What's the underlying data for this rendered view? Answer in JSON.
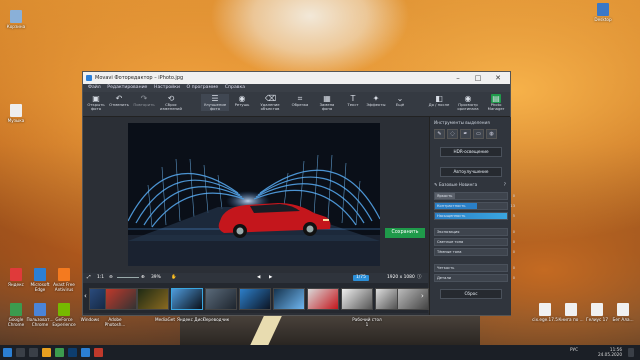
{
  "desktop": {
    "left_icons": [
      {
        "label": "Корзина",
        "color": "#8ab0d8"
      },
      {
        "label": "Яндекс",
        "color": "#e03a3a"
      },
      {
        "label": "Google Chrome",
        "color": "#3c9b4e"
      },
      {
        "label": "Музыка",
        "color": "#eee"
      },
      {
        "label": "Microsoft Edge",
        "color": "#2b7fd4"
      },
      {
        "label": "Пользоват... Chrome",
        "color": "#4a84d8"
      },
      {
        "label": "Avast Free Antivirus",
        "color": "#f47a1f"
      },
      {
        "label": "GeForce Experience",
        "color": "#76b900"
      },
      {
        "label": "Windows",
        "color": "#2a2a2a"
      },
      {
        "label": "Adobe Photosh...",
        "color": "#0d3d6e"
      },
      {
        "label": "MediaGet",
        "color": "#2ca84a"
      },
      {
        "label": "Яндекс Диск",
        "color": "#2f6fc0"
      },
      {
        "label": "Переводчик",
        "color": "#c0392b"
      }
    ],
    "right_icons": [
      {
        "label": "Desktop",
        "color": "#3a78c6"
      },
      {
        "label": "Рабочий стол 1",
        "color": "#d4d4d4"
      },
      {
        "label": "cix.ege.17.5",
        "color": "#f0f0f0"
      },
      {
        "label": "Книга по ...",
        "color": "#f0f0f0"
      },
      {
        "label": "Гелиус 17",
        "color": "#f0f0f0"
      },
      {
        "label": "Бег Ала...",
        "color": "#f0f0f0"
      }
    ]
  },
  "window": {
    "title": "Movavi Фоторедактор – iPhoto.jpg",
    "controls": {
      "minimize": "–",
      "maximize": "□",
      "close": "✕"
    },
    "menu": [
      "Файл",
      "Редактирование",
      "Настройки",
      "О программе",
      "Справка"
    ],
    "toolbar": [
      {
        "label": "Открыть фото",
        "icon": "folder-icon",
        "glyph": "▣"
      },
      {
        "label": "Отменить",
        "icon": "undo-icon",
        "glyph": "↶"
      },
      {
        "label": "Повторить",
        "icon": "redo-icon",
        "glyph": "↷"
      },
      {
        "label": "Сброс изменений",
        "icon": "reset-icon",
        "glyph": "⟲"
      },
      {
        "label": "Улучшение фото",
        "icon": "enhance-icon",
        "glyph": "☰"
      },
      {
        "label": "Ретушь",
        "icon": "retouch-icon",
        "glyph": "◉"
      },
      {
        "label": "Удаление объектов",
        "icon": "eraser-icon",
        "glyph": "⌫"
      },
      {
        "label": "Обрезка",
        "icon": "crop-icon",
        "glyph": "⌗"
      },
      {
        "label": "Замена фона",
        "icon": "background-icon",
        "glyph": "▦"
      },
      {
        "label": "Текст",
        "icon": "text-icon",
        "glyph": "T"
      },
      {
        "label": "Эффекты",
        "icon": "effects-icon",
        "glyph": "✦"
      },
      {
        "label": "Ещё",
        "icon": "more-icon",
        "glyph": "⌄"
      },
      {
        "label": "До / после",
        "icon": "before-after-icon",
        "glyph": "◧"
      },
      {
        "label": "Просмотр оригинала",
        "icon": "eye-icon",
        "glyph": "◉"
      },
      {
        "label": "Photo Manager",
        "icon": "photo-manager-icon",
        "glyph": "▤"
      }
    ],
    "zoom": {
      "fit": "1:1",
      "value": "39%"
    },
    "image_size": "1920 x 1080",
    "page_badge": "1/75",
    "panel": {
      "tools_label": "Инструменты выделения",
      "hdr_button": "HDR-освещение",
      "auto_button": "Автоулучшение",
      "basic_header": "Базовые Новинга",
      "sliders": [
        {
          "label": "Яркость",
          "value": 0,
          "color": "#5a606a"
        },
        {
          "label": "Контрастность",
          "value": 13,
          "color": "#2a7fc7"
        },
        {
          "label": "Насыщенность",
          "value": 5,
          "color": "#3aa6e0"
        },
        {
          "label": "Экспозиция",
          "value": 0,
          "color": "#3e444d"
        },
        {
          "label": "Светлые тона",
          "value": 0,
          "color": "#3e444d"
        },
        {
          "label": "Тёмные тона",
          "value": 0,
          "color": "#3e444d"
        },
        {
          "label": "Четкость",
          "value": 0,
          "color": "#3e444d"
        },
        {
          "label": "Детали",
          "value": 0,
          "color": "#3e444d"
        }
      ],
      "reset_button": "Сброс",
      "save_button": "Сохранить"
    }
  },
  "taskbar": {
    "time": "11:56",
    "date": "24.05.2020",
    "lang": "РУС"
  }
}
